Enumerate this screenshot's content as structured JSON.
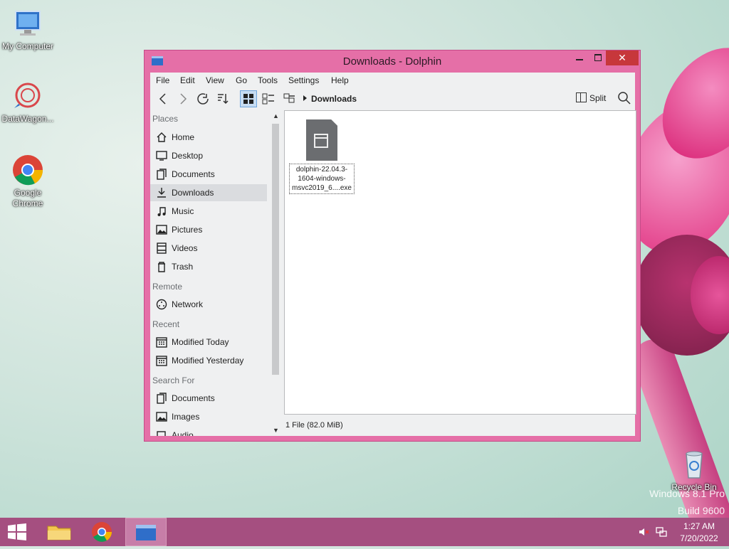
{
  "desktop": {
    "icons": [
      {
        "label": "My Computer"
      },
      {
        "label": "DataWagon..."
      },
      {
        "label": "Google Chrome"
      },
      {
        "label": "Recycle Bin"
      }
    ],
    "watermark_line1": "Windows 8.1 Pro",
    "watermark_line2": "Build 9600"
  },
  "window": {
    "title": "Downloads - Dolphin",
    "close_glyph": "✕",
    "menu": [
      "File",
      "Edit",
      "View",
      "Go",
      "Tools",
      "Settings",
      "Help"
    ],
    "breadcrumb": "Downloads",
    "split_label": "Split",
    "places": {
      "section_places": "Places",
      "items_places": [
        "Home",
        "Desktop",
        "Documents",
        "Downloads",
        "Music",
        "Pictures",
        "Videos",
        "Trash"
      ],
      "section_remote": "Remote",
      "items_remote": [
        "Network"
      ],
      "section_recent": "Recent",
      "items_recent": [
        "Modified Today",
        "Modified Yesterday"
      ],
      "section_search": "Search For",
      "items_search": [
        "Documents",
        "Images",
        "Audio"
      ]
    },
    "file": {
      "name_line1": "dolphin-22.04.3-",
      "name_line2": "1604-windows-",
      "name_line3": "msvc2019_6....exe"
    },
    "status": "1 File (82.0 MiB)"
  },
  "taskbar": {
    "time": "1:27 AM",
    "date": "7/20/2022"
  },
  "colors": {
    "window_frame": "#e56fa7",
    "taskbar": "#a54f80",
    "close_button": "#c7373b"
  }
}
